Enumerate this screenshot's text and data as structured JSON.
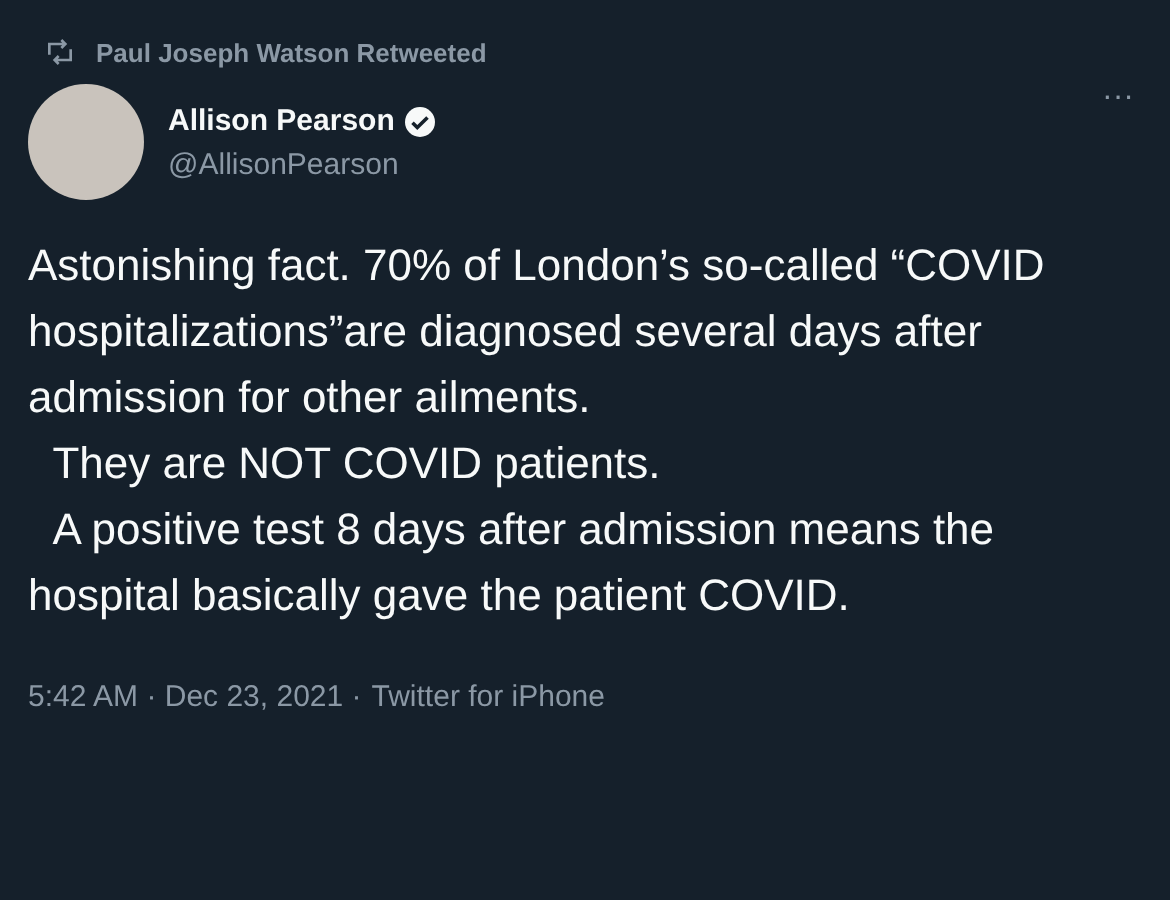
{
  "retweet_banner": {
    "text": "Paul Joseph Watson Retweeted"
  },
  "author": {
    "name": "Allison Pearson",
    "verified": true,
    "handle": "@AllisonPearson"
  },
  "more_button": "···",
  "tweet_text": "Astonishing fact. 70% of London’s so-called “COVID hospitalizations”are diagnosed several days after admission for other ailments.\n  They are NOT COVID patients.\n  A positive test 8 days after admission means the hospital basically gave the patient COVID.",
  "timestamp": "5:42 AM · Dec 23, 2021 ·",
  "source": "Twitter for iPhone"
}
